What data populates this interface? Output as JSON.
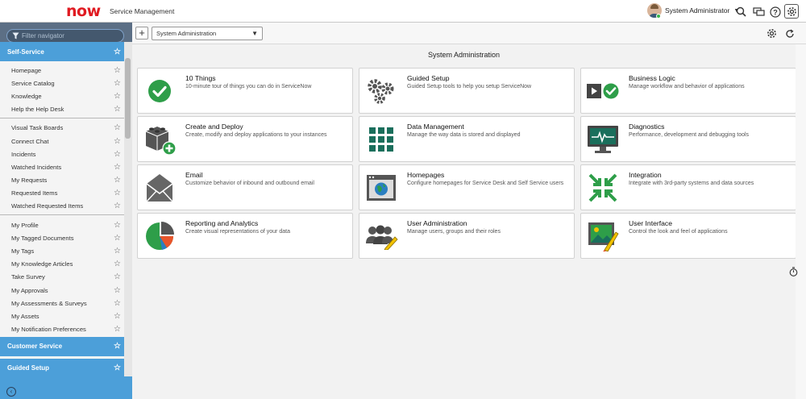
{
  "header": {
    "logo_text": "now",
    "app_name": "Service Management",
    "user_name": "System Administrator",
    "user_caret": "▼",
    "icons": [
      "search-icon",
      "chat-icon",
      "help-icon",
      "gear-icon"
    ]
  },
  "sidebar": {
    "filter_placeholder": "Filter navigator",
    "tabs": [
      "all-apps-icon",
      "favorites-star-icon",
      "history-clock-icon"
    ],
    "sections": [
      {
        "title": "Self-Service",
        "groups": [
          [
            "Homepage",
            "Service Catalog",
            "Knowledge",
            "Help the Help Desk"
          ],
          [
            "Visual Task Boards",
            "Connect Chat",
            "Incidents",
            "Watched Incidents",
            "My Requests",
            "Requested Items",
            "Watched Requested Items"
          ],
          [
            "My Profile",
            "My Tagged Documents",
            "My Tags",
            "My Knowledge Articles",
            "Take Survey",
            "My Approvals",
            "My Assessments & Surveys",
            "My Assets",
            "My Notification Preferences"
          ]
        ]
      },
      {
        "title": "Customer Service",
        "groups": []
      },
      {
        "title": "Guided Setup",
        "groups": []
      }
    ],
    "star_glyph": "☆",
    "collapse_glyph": "‹"
  },
  "toolbar": {
    "plus_label": "+",
    "select_value": "System Administration",
    "select_arrow": "▼"
  },
  "main": {
    "title": "System Administration",
    "cards": [
      {
        "title": "10 Things",
        "desc": "10-minute tour of things you can do in ServiceNow",
        "icon": "checkmark-icon"
      },
      {
        "title": "Guided Setup",
        "desc": "Guided Setup tools to help you setup ServiceNow",
        "icon": "gears-icon"
      },
      {
        "title": "Business Logic",
        "desc": "Manage workflow and behavior of applications",
        "icon": "play-check-icon"
      },
      {
        "title": "Create and Deploy",
        "desc": "Create, modify and deploy applications to your instances",
        "icon": "blocks-add-icon"
      },
      {
        "title": "Data Management",
        "desc": "Manage the way data is stored and displayed",
        "icon": "grid-icon"
      },
      {
        "title": "Diagnostics",
        "desc": "Performance, development and debugging tools",
        "icon": "monitor-pulse-icon"
      },
      {
        "title": "Email",
        "desc": "Customize behavior of inbound and outbound email",
        "icon": "envelope-icon"
      },
      {
        "title": "Homepages",
        "desc": "Configure homepages for Service Desk and Self Service users",
        "icon": "browser-globe-icon"
      },
      {
        "title": "Integration",
        "desc": "Integrate with 3rd-party systems and data sources",
        "icon": "arrows-in-icon"
      },
      {
        "title": "Reporting and Analytics",
        "desc": "Create visual representations of your data",
        "icon": "pie-chart-icon"
      },
      {
        "title": "User Administration",
        "desc": "Manage users, groups and their roles",
        "icon": "users-pencil-icon"
      },
      {
        "title": "User Interface",
        "desc": "Control the look and feel of applications",
        "icon": "picture-brush-icon"
      }
    ]
  },
  "colors": {
    "accent_blue": "#4c9fd9",
    "sidebar_bg": "#5c6f85",
    "icon_green": "#2e9e49",
    "icon_teal": "#1a6f5c",
    "icon_gray": "#555555",
    "logo_red": "#e01b22"
  }
}
